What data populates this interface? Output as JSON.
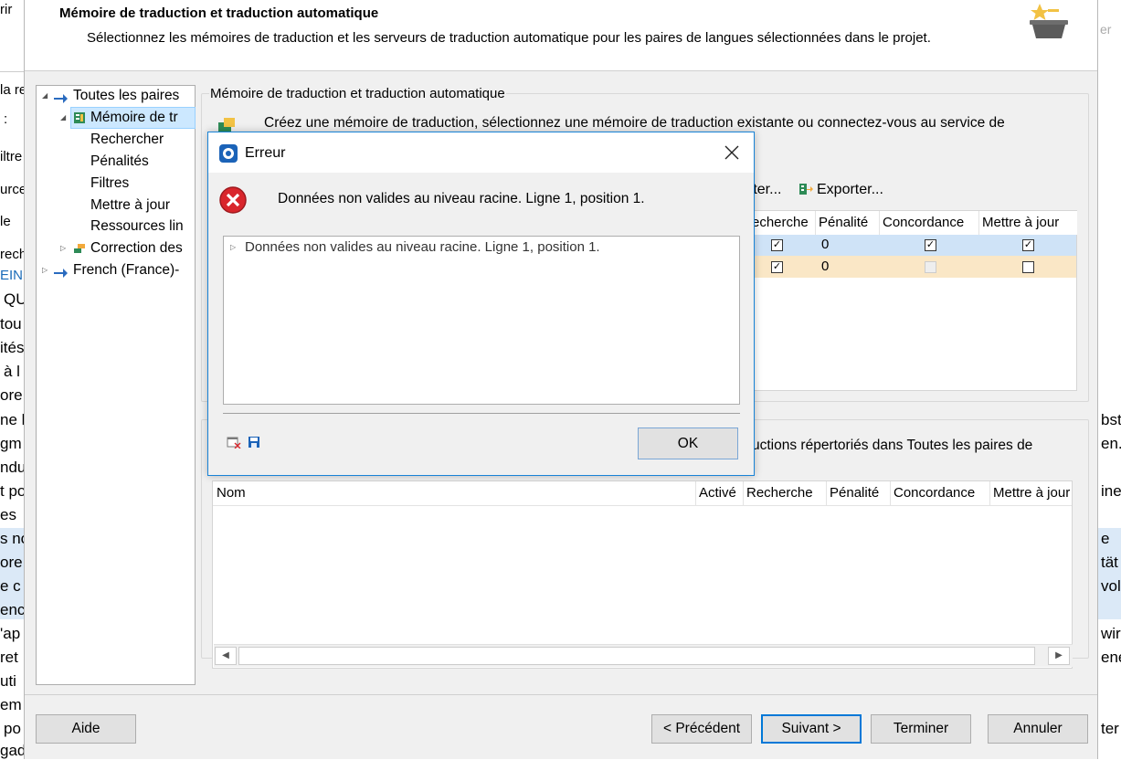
{
  "background": {
    "left_fragments": [
      "rir",
      "la re",
      ":",
      "iltre",
      "urce",
      "le",
      "rech",
      "EIN",
      "QU",
      "tou",
      "ités",
      "à l",
      "ore",
      "ne l",
      "gm",
      "ndu",
      "t po",
      "es",
      "s no",
      "ore",
      "e c",
      "enc",
      "'ap",
      "ret",
      "uti",
      "em",
      "po",
      "gad"
    ],
    "right_fragments": [
      "er",
      "bst",
      "en.",
      "ine",
      "e",
      "tät",
      "vol",
      "wir",
      "ene",
      "ter"
    ]
  },
  "wizard": {
    "title": "Mémoire de traduction et traduction automatique",
    "description": "Sélectionnez les mémoires de traduction et les serveurs de traduction automatique pour les paires de langues sélectionnées dans le projet.",
    "tree": {
      "all_pairs": "Toutes les paires",
      "tm": "Mémoire de tr",
      "search": "Rechercher",
      "penalties": "Pénalités",
      "filters": "Filtres",
      "update": "Mettre à jour",
      "resources": "Ressources lin",
      "correction": "Correction des",
      "french": "French (France)-"
    },
    "group1": {
      "title": "Mémoire de traduction et traduction automatique",
      "intro": "Créez une mémoire de traduction, sélectionnez une mémoire de traduction existante ou connectez-vous au service de",
      "import_label": "rter...",
      "export_label": "Exporter...",
      "columns": [
        "echerche",
        "Pénalité",
        "Concordance",
        "Mettre à jour"
      ],
      "rows": [
        {
          "recherche": "✓",
          "penalite": "0",
          "concordance": "✓",
          "maj": "✓"
        },
        {
          "recherche": "✓",
          "penalite": "0",
          "concordance": "",
          "maj": ""
        }
      ]
    },
    "group2": {
      "intro": "uctions répertoriés dans Toutes les paires de",
      "columns": [
        "Nom",
        "Activé",
        "Recherche",
        "Pénalité",
        "Concordance",
        "Mettre à jour"
      ]
    },
    "buttons": {
      "help": "Aide",
      "previous": "< Précédent",
      "next": "Suivant >",
      "finish": "Terminer",
      "cancel": "Annuler"
    }
  },
  "dialog": {
    "title": "Erreur",
    "message": "Données non valides au niveau racine. Ligne 1, position 1.",
    "detail": "Données non valides au niveau racine. Ligne 1, position 1.",
    "ok_label": "OK"
  },
  "colors": {
    "selection": "#cce8ff",
    "row_blue": "#cfe3f7",
    "row_beige": "#fae7c6",
    "accent": "#0078d7",
    "error_red": "#d9262c"
  }
}
